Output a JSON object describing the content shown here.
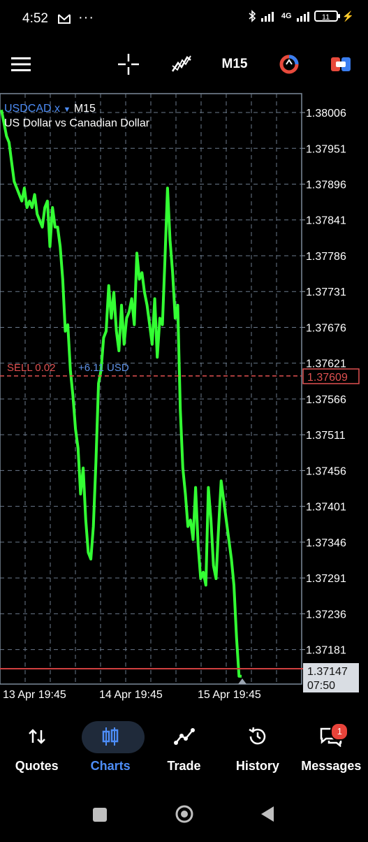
{
  "status": {
    "time": "4:52",
    "battery": "11",
    "network": "4G"
  },
  "toolbar": {
    "timeframe": "M15"
  },
  "chart": {
    "symbol": "USDCAD.x",
    "timeframe": "M15",
    "description": "US Dollar vs Canadian Dollar",
    "position_label": "SELL 0.02",
    "position_profit": "+6.11 USD",
    "price_labels": [
      "1.38006",
      "1.37951",
      "1.37896",
      "1.37841",
      "1.37786",
      "1.37731",
      "1.37676",
      "1.37621",
      "1.37566",
      "1.37511",
      "1.37456",
      "1.37401",
      "1.37346",
      "1.37291",
      "1.37236",
      "1.37181"
    ],
    "order_price": "1.37609",
    "bid_price": "1.37147",
    "bar_timer": "07:50",
    "time_labels": [
      "13 Apr 19:45",
      "14 Apr 19:45",
      "15 Apr 19:45"
    ],
    "colors": {
      "candles": "#33ff33",
      "sell_line": "#e05050",
      "bid_line": "#d04040",
      "grid": "#6b7a8c",
      "symbol": "#4d8df7"
    }
  },
  "nav": {
    "items": [
      {
        "label": "Quotes"
      },
      {
        "label": "Charts"
      },
      {
        "label": "Trade"
      },
      {
        "label": "History"
      },
      {
        "label": "Messages",
        "badge": "1"
      }
    ]
  },
  "chart_data": {
    "type": "line",
    "series": [
      {
        "values": [
          1.3801,
          1.3799,
          1.3797,
          1.3796,
          1.3793,
          1.379,
          1.3789,
          1.3788,
          1.3787,
          1.3789,
          1.3786,
          1.3787,
          1.3786,
          1.3788,
          1.3785,
          1.3784,
          1.3783,
          1.3786,
          1.3787,
          1.378,
          1.3786,
          1.3783,
          1.3783,
          1.378,
          1.3775,
          1.3767,
          1.3768,
          1.3761,
          1.3757,
          1.3752,
          1.3749,
          1.3742,
          1.3746,
          1.3738,
          1.3733,
          1.3732,
          1.3737,
          1.3747,
          1.3759,
          1.3761,
          1.3766,
          1.3767,
          1.3774,
          1.3769,
          1.3773,
          1.3767,
          1.3764,
          1.3771,
          1.3765,
          1.3769,
          1.377,
          1.3772,
          1.3768,
          1.3779,
          1.3775,
          1.3776,
          1.3773,
          1.3771,
          1.3768,
          1.3765,
          1.3772,
          1.3763,
          1.3769,
          1.3768,
          1.3778,
          1.3789,
          1.3781,
          1.3776,
          1.3769,
          1.3771,
          1.3755,
          1.3746,
          1.3742,
          1.3737,
          1.3738,
          1.3735,
          1.3743,
          1.3734,
          1.3729,
          1.373,
          1.3728,
          1.3743,
          1.3738,
          1.3731,
          1.3729,
          1.3737,
          1.3744,
          1.3741,
          1.3738,
          1.3735,
          1.3732,
          1.3728,
          1.372,
          1.3714,
          1.3714
        ]
      }
    ],
    "ylim": [
      1.37128,
      1.38035
    ]
  }
}
